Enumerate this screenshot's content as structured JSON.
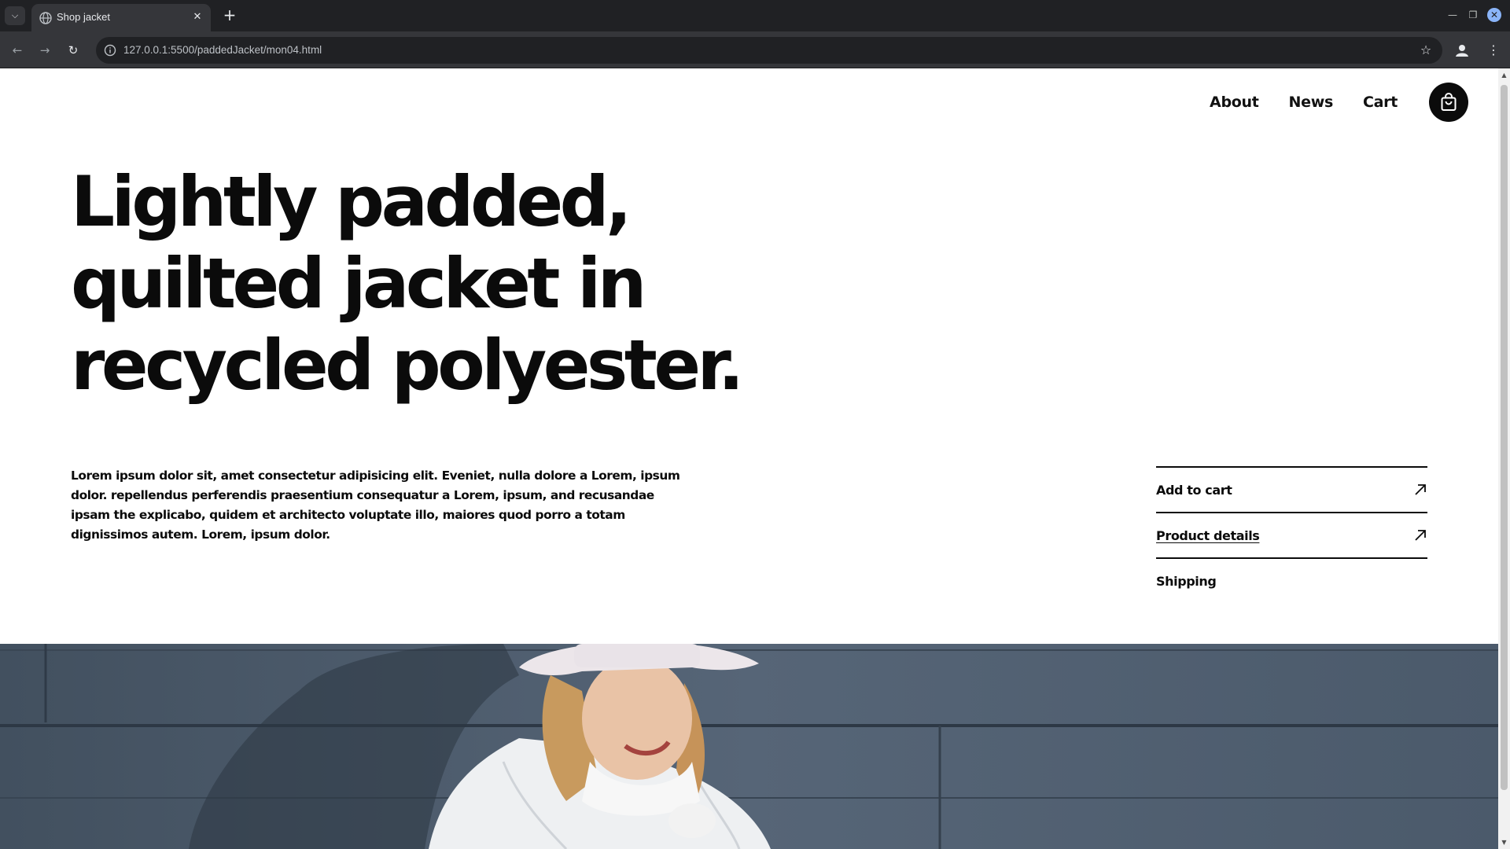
{
  "browser": {
    "tab_title": "Shop jacket",
    "url": "127.0.0.1:5500/paddedJacket/mon04.html"
  },
  "nav": {
    "items": [
      "About",
      "News",
      "Cart"
    ],
    "cart_icon": "shopping-bag-icon"
  },
  "hero": {
    "headline_lines": [
      "Lightly padded,",
      "quilted jacket in",
      "recycled polyester."
    ],
    "description": "Lorem ipsum dolor sit, amet consectetur adipisicing elit. Eveniet, nulla dolore a Lorem, ipsum dolor. repellendus perferendis praesentium consequatur a Lorem, ipsum, and recusandae ipsam the explicabo, quidem et architecto voluptate illo, maiores quod porro a totam dignissimos autem. Lorem, ipsum dolor."
  },
  "side_menu": {
    "items": [
      {
        "label": "Add to cart",
        "icon": "arrow-up-right-icon"
      },
      {
        "label": "Product details",
        "icon": "arrow-up-right-icon"
      },
      {
        "label": "Shipping"
      }
    ]
  },
  "colors": {
    "text": "#0b0b0b",
    "chrome_dark": "#202124",
    "chrome_toolbar": "#35363a",
    "photo_wall": "#4f5d6e"
  }
}
